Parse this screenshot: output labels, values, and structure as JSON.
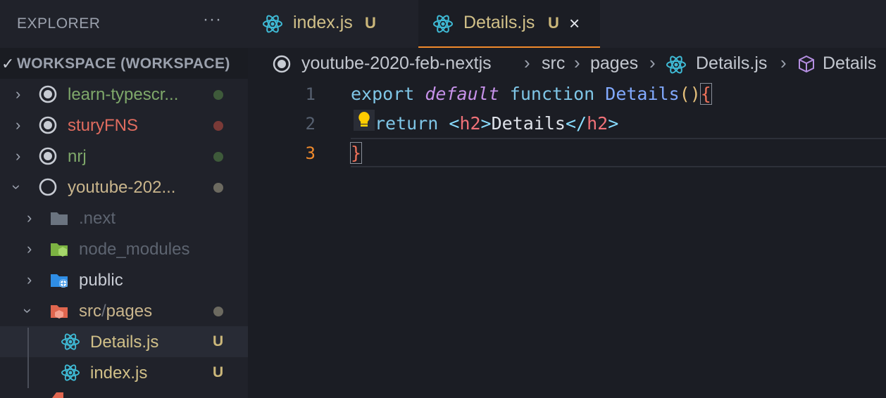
{
  "sidebar": {
    "title": "EXPLORER",
    "more_label": "···",
    "workspace_label": "WORKSPACE (WORKSPACE)",
    "items": [
      {
        "label": "learn-typescr...",
        "color": "#7fa86a",
        "status": "dot",
        "dot_color": "#3e5a3a"
      },
      {
        "label": "sturyFNS",
        "color": "#e06c5f",
        "status": "dot",
        "dot_color": "#7a3a37"
      },
      {
        "label": "nrj",
        "color": "#7fa86a",
        "status": "dot",
        "dot_color": "#3e5a3a"
      },
      {
        "label": "youtube-202...",
        "color": "#c9b58c",
        "status": "dot",
        "dot_color": "#6c6a60"
      },
      {
        "label": ".next",
        "color": "#5d6470"
      },
      {
        "label": "node_modules",
        "color": "#5d6470"
      },
      {
        "label": "public",
        "color": "#c8ccd4"
      },
      {
        "label_a": "src",
        "label_sep": "/",
        "label_b": "pages",
        "color": "#c9b58c",
        "status": "dot",
        "dot_color": "#6c6a60"
      },
      {
        "label": "Details.js",
        "color": "#d1c088",
        "badge": "U"
      },
      {
        "label": "index.js",
        "color": "#d1c088",
        "badge": "U"
      }
    ]
  },
  "tabs": [
    {
      "label": "index.js",
      "badge": "U",
      "active": false
    },
    {
      "label": "Details.js",
      "badge": "U",
      "active": true,
      "close_icon": "×"
    }
  ],
  "breadcrumbs": [
    "youtube-2020-feb-nextjs",
    "src",
    "pages",
    "Details.js",
    "Details"
  ],
  "breadcrumb_separator": "›",
  "code": {
    "line_numbers": [
      "1",
      "2",
      "3"
    ],
    "line1": {
      "kw": "export",
      "it": "default",
      "kw2": "function",
      "fn": "Details",
      "parens": "()",
      "brace": "{"
    },
    "line2": {
      "kw": "return",
      "lt": "<",
      "tag": "h2",
      "gt": ">",
      "text": "Details",
      "lt2": "</",
      "tag2": "h2",
      "gt2": ">"
    },
    "line3": {
      "brace": "}"
    }
  },
  "colors": {
    "accent": "#f08a2c",
    "react_icon": "#3fbbd6",
    "untracked": "#cbb77a"
  }
}
